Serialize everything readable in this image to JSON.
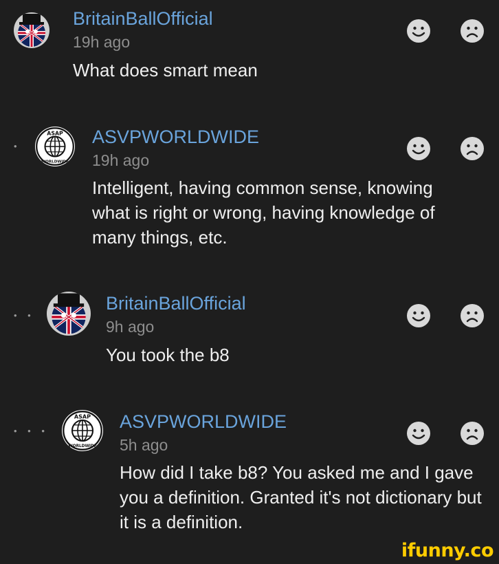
{
  "comments": [
    {
      "username": "BritainBallOfficial",
      "time": "19h ago",
      "text": "What does smart mean",
      "depth_dots": "",
      "avatar_icon": "britainball-avatar-icon"
    },
    {
      "username": "ASVPWORLDWIDE",
      "time": "19h ago",
      "text": "Intelligent, having common sense, knowing what is right or wrong, having knowledge of many things, etc.",
      "depth_dots": "•",
      "avatar_icon": "asap-worldwide-logo-icon"
    },
    {
      "username": "BritainBallOfficial",
      "time": "9h ago",
      "text": "You took the b8",
      "depth_dots": "• •",
      "avatar_icon": "britainball-avatar-icon"
    },
    {
      "username": "ASVPWORLDWIDE",
      "time": "5h ago",
      "text": "How did I take b8? You asked me and I gave you a definition. Granted it's not dictionary but it is a definition.",
      "depth_dots": "• • •",
      "avatar_icon": "asap-worldwide-logo-icon"
    }
  ],
  "watermark": "ifunny.co",
  "colors": {
    "background": "#1e1e1e",
    "username": "#6aa4dc",
    "timestamp": "#8e8e8e",
    "reaction_icon": "#d6d6d6"
  }
}
